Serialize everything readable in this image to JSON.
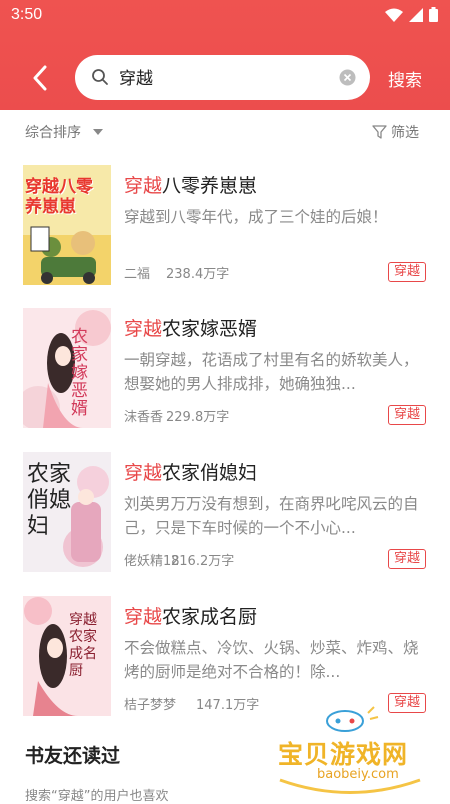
{
  "status_bar": {
    "time": "3:50"
  },
  "search": {
    "query": "穿越",
    "submit_label": "搜索"
  },
  "filter": {
    "sort_label": "综合排序",
    "filter_label": "筛选"
  },
  "books": [
    {
      "title_highlight": "穿越",
      "title_rest": "八零养崽崽",
      "description": "穿越到八零年代，成了三个娃的后娘！",
      "author": "二福",
      "words": "238.4万字",
      "tag": "穿越",
      "cover_text": "穿越八零养崽崽"
    },
    {
      "title_highlight": "穿越",
      "title_rest": "农家嫁恶婿",
      "description": "一朝穿越，花语成了村里有名的娇软美人，想娶她的男人排成排，她确独独...",
      "author": "沫香香",
      "words": "229.8万字",
      "tag": "穿越",
      "cover_text": "农家嫁恶婿"
    },
    {
      "title_highlight": "穿越",
      "title_rest": "农家俏媳妇",
      "description": "刘英男万万没有想到，在商界叱咤风云的自己，只是下车时候的一个不小心...",
      "author": "佬妖精18",
      "words": "216.2万字",
      "tag": "穿越",
      "cover_text": "农家俏媳妇"
    },
    {
      "title_highlight": "穿越",
      "title_rest": "农家成名厨",
      "description": "不会做糕点、冷饮、火锅、炒菜、炸鸡、烧烤的厨师是绝对不合格的！除...",
      "author": "桔子梦梦",
      "words": "147.1万字",
      "tag": "穿越",
      "cover_text": "穿越农家成名厨"
    }
  ],
  "section": {
    "title": "书友还读过",
    "subtitle": "搜索“穿越”的用户也喜欢"
  },
  "watermark": {
    "text": "宝贝游戏网",
    "url": "baobeiy.com"
  },
  "colors": {
    "accent": "#e84849",
    "header": "#ef5350"
  }
}
